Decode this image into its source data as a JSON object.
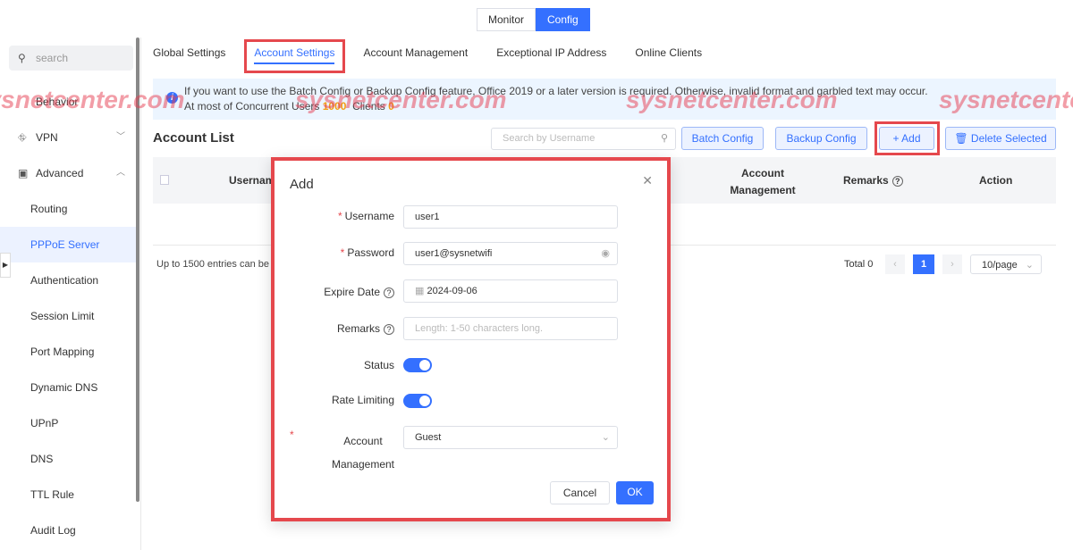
{
  "top_toggle": {
    "monitor": "Monitor",
    "config": "Config"
  },
  "sidebar": {
    "search_placeholder": "search",
    "items": [
      {
        "label": "Behavior",
        "icon": "behavior-icon"
      },
      {
        "label": "VPN",
        "icon": "vpn-icon"
      },
      {
        "label": "Advanced",
        "icon": "briefcase-icon"
      },
      {
        "label": "Routing"
      },
      {
        "label": "PPPoE Server",
        "active": true
      },
      {
        "label": "Authentication"
      },
      {
        "label": "Session Limit"
      },
      {
        "label": "Port Mapping"
      },
      {
        "label": "Dynamic DNS"
      },
      {
        "label": "UPnP"
      },
      {
        "label": "DNS"
      },
      {
        "label": "TTL Rule"
      },
      {
        "label": "Audit Log"
      }
    ]
  },
  "tabs": [
    "Global Settings",
    "Account Settings",
    "Account Management",
    "Exceptional IP Address",
    "Online Clients"
  ],
  "notice": {
    "line1": "If you want to use the Batch Config or Backup Config feature, Office 2019 or a later version is required. Otherwise, invalid format and garbled text may occur.",
    "users_label": "At most of Concurrent Users",
    "users_value": "1000",
    "clients_label": "Clients",
    "clients_value": "0"
  },
  "account_list": {
    "title": "Account List",
    "search_placeholder": "Search by Username",
    "batch": "Batch Config",
    "backup": "Backup Config",
    "add": "+ Add",
    "delete": "Delete Selected",
    "columns": [
      "Username",
      "Account Management",
      "Remarks",
      "Action"
    ],
    "footer": "Up to 1500 entries can be",
    "total": "Total 0",
    "page": "1",
    "page_size": "10/page"
  },
  "modal": {
    "title": "Add",
    "username_label": "Username",
    "username": "user1",
    "password_label": "Password",
    "password": "user1@sysnetwifi",
    "expire_label": "Expire Date",
    "expire": "2024-09-06",
    "remarks_label": "Remarks",
    "remarks_placeholder": "Length: 1-50 characters long.",
    "status_label": "Status",
    "status_on": true,
    "rate_label": "Rate Limiting",
    "rate_on": true,
    "acct_label_1": "Account",
    "acct_label_2": "Management",
    "acct_value": "Guest",
    "cancel": "Cancel",
    "ok": "OK"
  },
  "watermark": "sysnetcenter.com",
  "colors": {
    "accent": "#3470ff",
    "highlight": "#e5484d"
  }
}
